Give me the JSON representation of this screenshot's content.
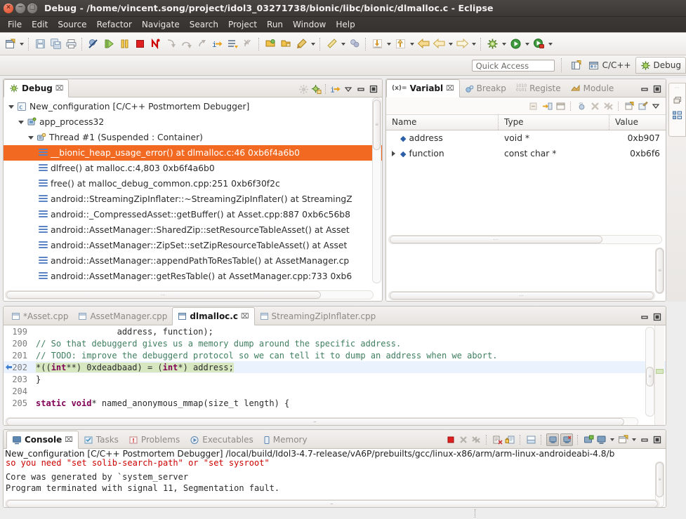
{
  "window": {
    "title": "Debug - /home/vincent.song/project/idol3_03271738/bionic/libc/bionic/dlmalloc.c - Eclipse",
    "close_glyph": "×",
    "min_glyph": "−",
    "max_glyph": "□"
  },
  "menu": {
    "items": [
      "File",
      "Edit",
      "Source",
      "Refactor",
      "Navigate",
      "Search",
      "Project",
      "Run",
      "Window",
      "Help"
    ]
  },
  "quick_access": {
    "placeholder": "Quick Access",
    "value": ""
  },
  "perspectives": [
    {
      "label": "C/C++",
      "icon": "cpp-perspective-icon",
      "active": false
    },
    {
      "label": "Debug",
      "icon": "debug-perspective-icon",
      "active": true
    }
  ],
  "debug_view": {
    "tabs": [
      {
        "label": "Debug",
        "active": true,
        "close": "⌧"
      }
    ],
    "actions": [
      "disconnect-icon",
      "relaunch-icon",
      "step-into-selection-icon",
      "view-menu-icon",
      "minimize-icon",
      "maximize-icon"
    ],
    "tree": [
      {
        "indent": 0,
        "twisty": "down",
        "icon": "launch-config-icon",
        "label": "New_configuration [C/C++ Postmortem Debugger]",
        "selected": false
      },
      {
        "indent": 1,
        "twisty": "down",
        "icon": "process-icon",
        "label": "app_process32",
        "selected": false
      },
      {
        "indent": 2,
        "twisty": "down",
        "icon": "thread-icon",
        "label": "Thread #1 (Suspended : Container)",
        "selected": false
      },
      {
        "indent": 3,
        "twisty": "none",
        "icon": "stack-frame-icon",
        "label": "__bionic_heap_usage_error() at dlmalloc.c:46 0xb6f4a6b0",
        "selected": true
      },
      {
        "indent": 3,
        "twisty": "none",
        "icon": "stack-frame-icon",
        "label": "dlfree() at malloc.c:4,803 0xb6f4a6b0",
        "selected": false
      },
      {
        "indent": 3,
        "twisty": "none",
        "icon": "stack-frame-icon",
        "label": "free() at malloc_debug_common.cpp:251 0xb6f30f2c",
        "selected": false
      },
      {
        "indent": 3,
        "twisty": "none",
        "icon": "stack-frame-icon",
        "label": "android::StreamingZipInflater::~StreamingZipInflater() at StreamingZ",
        "selected": false
      },
      {
        "indent": 3,
        "twisty": "none",
        "icon": "stack-frame-icon",
        "label": "android::_CompressedAsset::getBuffer() at Asset.cpp:887 0xb6c56b8",
        "selected": false
      },
      {
        "indent": 3,
        "twisty": "none",
        "icon": "stack-frame-icon",
        "label": "android::AssetManager::SharedZip::setResourceTableAsset() at Asset",
        "selected": false
      },
      {
        "indent": 3,
        "twisty": "none",
        "icon": "stack-frame-icon",
        "label": "android::AssetManager::ZipSet::setZipResourceTableAsset() at Asset",
        "selected": false
      },
      {
        "indent": 3,
        "twisty": "none",
        "icon": "stack-frame-icon",
        "label": "android::AssetManager::appendPathToResTable() at AssetManager.cp",
        "selected": false
      },
      {
        "indent": 3,
        "twisty": "none",
        "icon": "stack-frame-icon",
        "label": "android::AssetManager::getResTable() at AssetManager.cpp:733 0xb6",
        "selected": false
      }
    ]
  },
  "variables_view": {
    "tabs": [
      {
        "label": "Variabl",
        "active": true,
        "icon": "variables-icon",
        "close": "⌧"
      },
      {
        "label": "Breakp",
        "active": false,
        "icon": "breakpoints-icon"
      },
      {
        "label": "Registe",
        "active": false,
        "icon": "registers-icon"
      },
      {
        "label": "Module",
        "active": false,
        "icon": "modules-icon"
      }
    ],
    "columns": [
      "Name",
      "Type",
      "Value"
    ],
    "rows": [
      {
        "twisty": "none",
        "name": "address",
        "type": "void *",
        "value": "0xb907"
      },
      {
        "twisty": "right",
        "name": "function",
        "type": "const char *",
        "value": "0xb6f6"
      }
    ],
    "actions": [
      "collapse-all-icon",
      "add-watch-icon",
      "layout-icon",
      "cast-icon",
      "remove-icon",
      "remove-all-icon",
      "new-watch-icon",
      "edit-watch-icon",
      "view-menu-icon"
    ]
  },
  "editor": {
    "tabs": [
      {
        "label": "*Asset.cpp",
        "active": false,
        "dirty": true
      },
      {
        "label": "AssetManager.cpp",
        "active": false,
        "dirty": false
      },
      {
        "label": "dlmalloc.c",
        "active": true,
        "dirty": false,
        "close": "⌧"
      },
      {
        "label": "StreamingZipInflater.cpp",
        "active": false,
        "dirty": false
      }
    ],
    "lines": [
      {
        "num": "199",
        "marker": "",
        "highlight": "none",
        "segments": [
          {
            "t": "                address, function);",
            "c": "plain"
          }
        ]
      },
      {
        "num": "200",
        "marker": "",
        "highlight": "none",
        "segments": [
          {
            "t": "// So that debuggerd gives us a memory dump around the specific address.",
            "c": "cmt"
          }
        ]
      },
      {
        "num": "201",
        "marker": "",
        "highlight": "none",
        "segments": [
          {
            "t": "// TODO: improve the debuggerd protocol so we can tell it to dump an address when we abort.",
            "c": "cmt"
          }
        ]
      },
      {
        "num": "202",
        "marker": "arrow",
        "highlight": "line",
        "segments": [
          {
            "t": "*((",
            "c": "plain"
          },
          {
            "t": "int",
            "c": "kw"
          },
          {
            "t": "**) 0xdeadbaad) = (",
            "c": "plain"
          },
          {
            "t": "int",
            "c": "kw"
          },
          {
            "t": "*) address;",
            "c": "plain"
          }
        ]
      },
      {
        "num": "203",
        "marker": "",
        "highlight": "none",
        "segments": [
          {
            "t": "}",
            "c": "plain"
          }
        ]
      },
      {
        "num": "204",
        "marker": "",
        "highlight": "none",
        "segments": [
          {
            "t": "",
            "c": "plain"
          }
        ]
      },
      {
        "num": "205",
        "marker": "",
        "highlight": "none",
        "segments": [
          {
            "t": "static void",
            "c": "kw"
          },
          {
            "t": "* named_anonymous_mmap(size_t length) {",
            "c": "plain"
          }
        ]
      }
    ]
  },
  "console_view": {
    "tabs": [
      {
        "label": "Console",
        "active": true,
        "icon": "console-icon",
        "close": "⌧"
      },
      {
        "label": "Tasks",
        "active": false,
        "icon": "tasks-icon"
      },
      {
        "label": "Problems",
        "active": false,
        "icon": "problems-icon"
      },
      {
        "label": "Executables",
        "active": false,
        "icon": "executables-icon"
      },
      {
        "label": "Memory",
        "active": false,
        "icon": "memory-icon"
      }
    ],
    "actions": [
      "terminate-icon",
      "remove-launch-icon",
      "remove-all-terminated-icon",
      "clear-console-icon",
      "lock-scroll-icon",
      "show-console-on-output-icon",
      "pin-console-icon",
      "display-selected-console-icon",
      "open-console-icon",
      "minimize-icon",
      "maximize-icon"
    ],
    "header": "New_configuration [C/C++ Postmortem Debugger] /local/build/Idol3-4.7-release/vA6P/prebuilts/gcc/linux-x86/arm/arm-linux-androideabi-4.8/b",
    "lines": [
      {
        "text": "so you need \"set solib-search-path\" or \"set sysroot\"",
        "kind": "err"
      },
      {
        "text": "Core was generated by `system_server",
        "kind": "out"
      },
      {
        "text": "Program terminated with signal 11, Segmentation fault.",
        "kind": "out"
      }
    ]
  }
}
